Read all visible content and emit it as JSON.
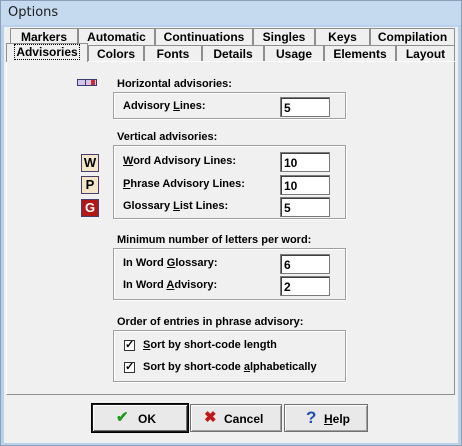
{
  "window": {
    "title": "Options"
  },
  "tabs_row1": [
    "Markers",
    "Automatic",
    "Continuations",
    "Singles",
    "Keys",
    "Compilation"
  ],
  "tabs_row2": [
    "Advisories",
    "Colors",
    "Fonts",
    "Details",
    "Usage",
    "Elements",
    "Layout"
  ],
  "active_tab": "Advisories",
  "horizontal": {
    "heading": "Horizontal advisories:",
    "advisory_lines_label_pre": "Advisory ",
    "advisory_lines_label_u": "L",
    "advisory_lines_label_post": "ines:",
    "advisory_lines_value": "5"
  },
  "vertical": {
    "heading": "Vertical advisories:",
    "word_label_u": "W",
    "word_label_post": "ord Advisory Lines:",
    "word_value": "10",
    "word_icon": "W",
    "phrase_label_u": "P",
    "phrase_label_post": "hrase Advisory Lines:",
    "phrase_value": "10",
    "phrase_icon": "P",
    "glossary_label_pre": "Glossary ",
    "glossary_label_u": "L",
    "glossary_label_post": "ist Lines:",
    "glossary_value": "5",
    "glossary_icon": "G"
  },
  "minimum": {
    "heading": "Minimum number of letters per word:",
    "glossary_label_pre": "In Word ",
    "glossary_label_u": "G",
    "glossary_label_post": "lossary:",
    "glossary_value": "6",
    "advisory_label_pre": "In Word ",
    "advisory_label_u": "A",
    "advisory_label_post": "dvisory:",
    "advisory_value": "2"
  },
  "order": {
    "heading": "Order of entries in phrase advisory:",
    "sort_length_u": "S",
    "sort_length_post": "ort by short-code length",
    "sort_length_checked": true,
    "sort_alpha_pre": "Sort by short-code ",
    "sort_alpha_u": "a",
    "sort_alpha_post": "lphabetically",
    "sort_alpha_checked": true
  },
  "buttons": {
    "ok": "OK",
    "cancel": "Cancel",
    "help_u": "H",
    "help_post": "elp"
  },
  "icons": {
    "ok": "check-icon",
    "cancel": "x-icon",
    "help": "question-icon",
    "advisory_lines": "horizontal-lines-icon"
  },
  "colors": {
    "ok_check": "#1e9a1e",
    "cancel_x": "#c01818",
    "help_q": "#1f4fbf",
    "glossary_icon_bg": "#b01818"
  }
}
